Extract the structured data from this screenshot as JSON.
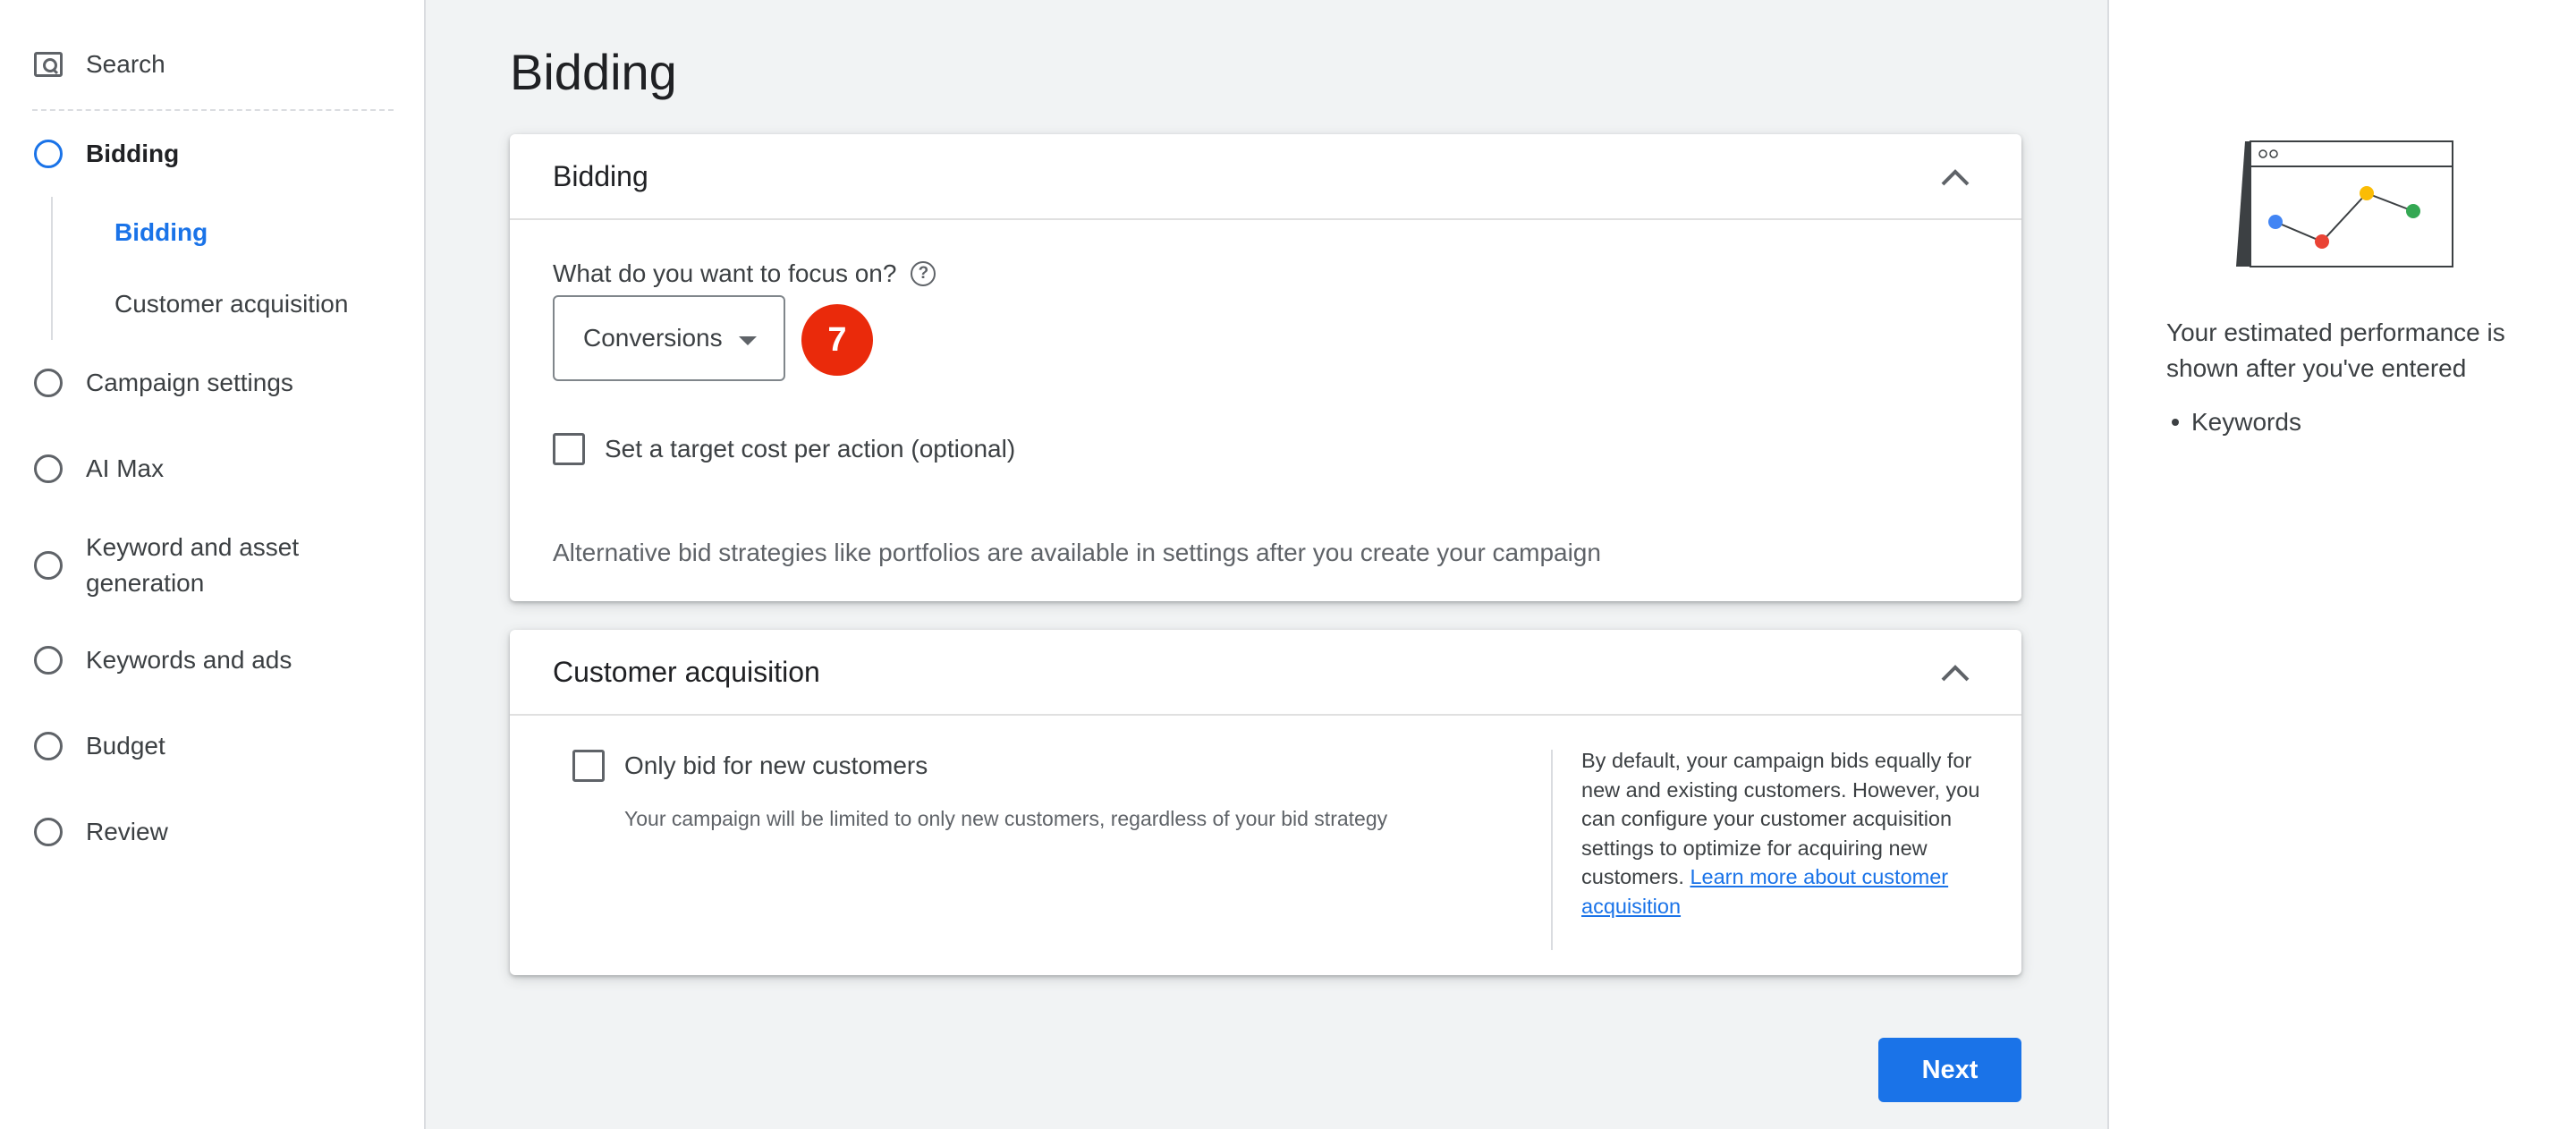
{
  "sidebar": {
    "search_label": "Search",
    "items": [
      {
        "label": "Bidding"
      },
      {
        "label": "Campaign settings"
      },
      {
        "label": "AI Max"
      },
      {
        "label": "Keyword and asset\ngeneration"
      },
      {
        "label": "Keywords and ads"
      },
      {
        "label": "Budget"
      },
      {
        "label": "Review"
      }
    ],
    "subitems": [
      {
        "label": "Bidding"
      },
      {
        "label": "Customer acquisition"
      }
    ]
  },
  "main": {
    "title": "Bidding",
    "bidding_card": {
      "title": "Bidding",
      "focus_label": "What do you want to focus on?",
      "help_glyph": "?",
      "dropdown_value": "Conversions",
      "step_badge": "7",
      "target_cpa_label": "Set a target cost per action (optional)",
      "alt_note": "Alternative bid strategies like portfolios are available in settings after you create your campaign"
    },
    "customer_card": {
      "title": "Customer acquisition",
      "checkbox_label": "Only bid for new customers",
      "checkbox_sub": "Your campaign will be limited to only new customers, regardless of your bid strategy",
      "info_text": "By default, your campaign bids equally for new and existing customers. However, you can configure your customer acquisition settings to optimize for acquiring new customers.",
      "info_link": "Learn more about customer acquisition"
    },
    "next_label": "Next"
  },
  "right_panel": {
    "perf_text": "Your estimated performance is shown after you've entered",
    "list": [
      "Keywords"
    ]
  },
  "colors": {
    "accent": "#1a73e8",
    "badge": "#ea2a0b",
    "dot_blue": "#4285f4",
    "dot_red": "#ea4335",
    "dot_yellow": "#fbbc04",
    "dot_green": "#34a853"
  }
}
